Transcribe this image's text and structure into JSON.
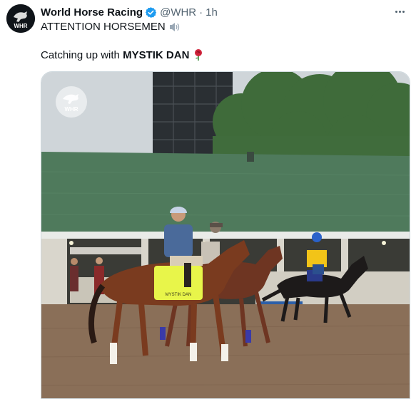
{
  "tweet": {
    "author_name": "World Horse Racing",
    "handle": "@WHR",
    "separator": "·",
    "time": "1h",
    "line1": "ATTENTION HORSEMEN",
    "line2_prefix": "Catching up with",
    "line2_bold": "MYSTIK DAN",
    "avatar_text": "WHR",
    "watermark_text": "WHR",
    "saddle_cloth_text": "MYSTIK DAN"
  },
  "icons": {
    "verified": "verified-badge-icon",
    "speaker": "speaker-icon",
    "rose": "rose-icon",
    "more": "more-dots-icon"
  },
  "colors": {
    "verified_blue": "#1d9bf0",
    "text_secondary": "#536471",
    "roof_green": "#4f7a5c",
    "saddle_cloth": "#e8f54a"
  }
}
